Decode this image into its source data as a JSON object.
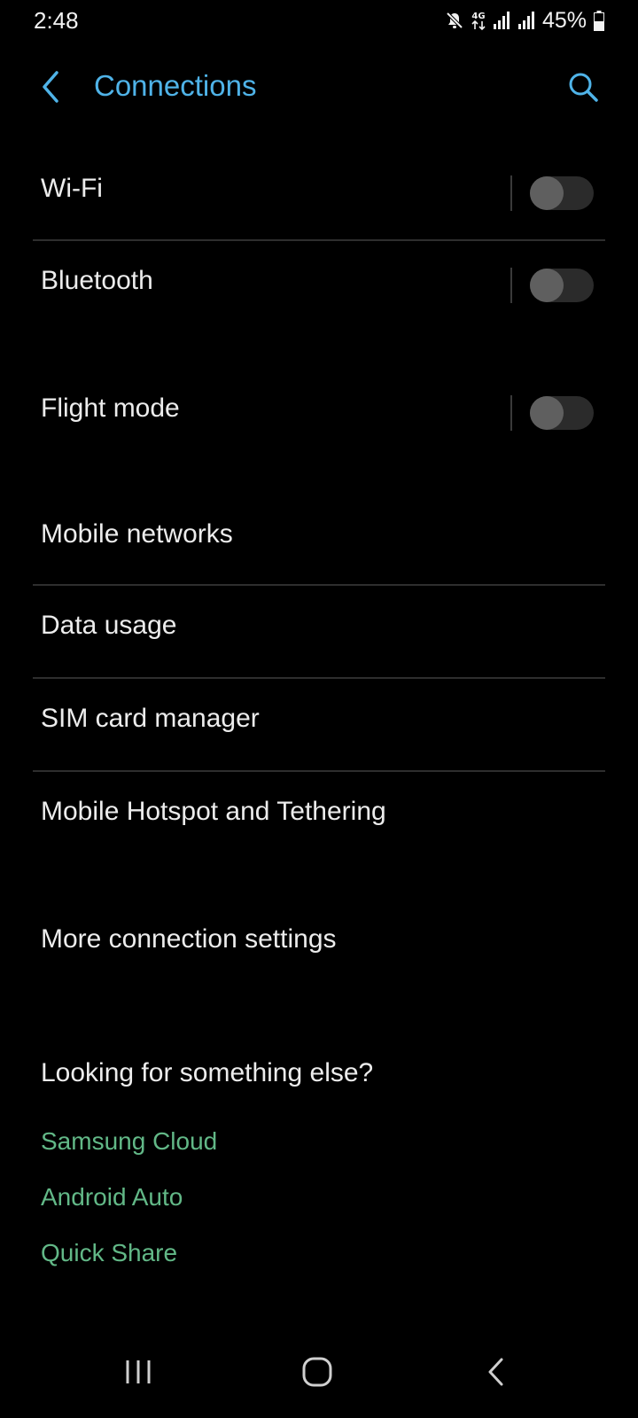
{
  "status_bar": {
    "time": "2:48",
    "network_type": "4G",
    "battery": "45%"
  },
  "header": {
    "title": "Connections"
  },
  "settings": {
    "wifi": {
      "label": "Wi-Fi",
      "enabled": false
    },
    "bluetooth": {
      "label": "Bluetooth",
      "enabled": false
    },
    "flight_mode": {
      "label": "Flight mode",
      "enabled": false
    },
    "mobile_networks": {
      "label": "Mobile networks"
    },
    "data_usage": {
      "label": "Data usage"
    },
    "sim_card_manager": {
      "label": "SIM card manager"
    },
    "hotspot": {
      "label": "Mobile Hotspot and Tethering"
    },
    "more_settings": {
      "label": "More connection settings"
    }
  },
  "suggestions": {
    "heading": "Looking for something else?",
    "links": [
      "Samsung Cloud",
      "Android Auto",
      "Quick Share"
    ]
  },
  "colors": {
    "accent": "#4fb3e8",
    "link": "#62b887",
    "background": "#000000"
  },
  "icons": {
    "back": "chevron-left-icon",
    "search": "search-icon",
    "recents": "recents-icon",
    "home": "home-icon",
    "nav_back": "nav-back-icon"
  }
}
